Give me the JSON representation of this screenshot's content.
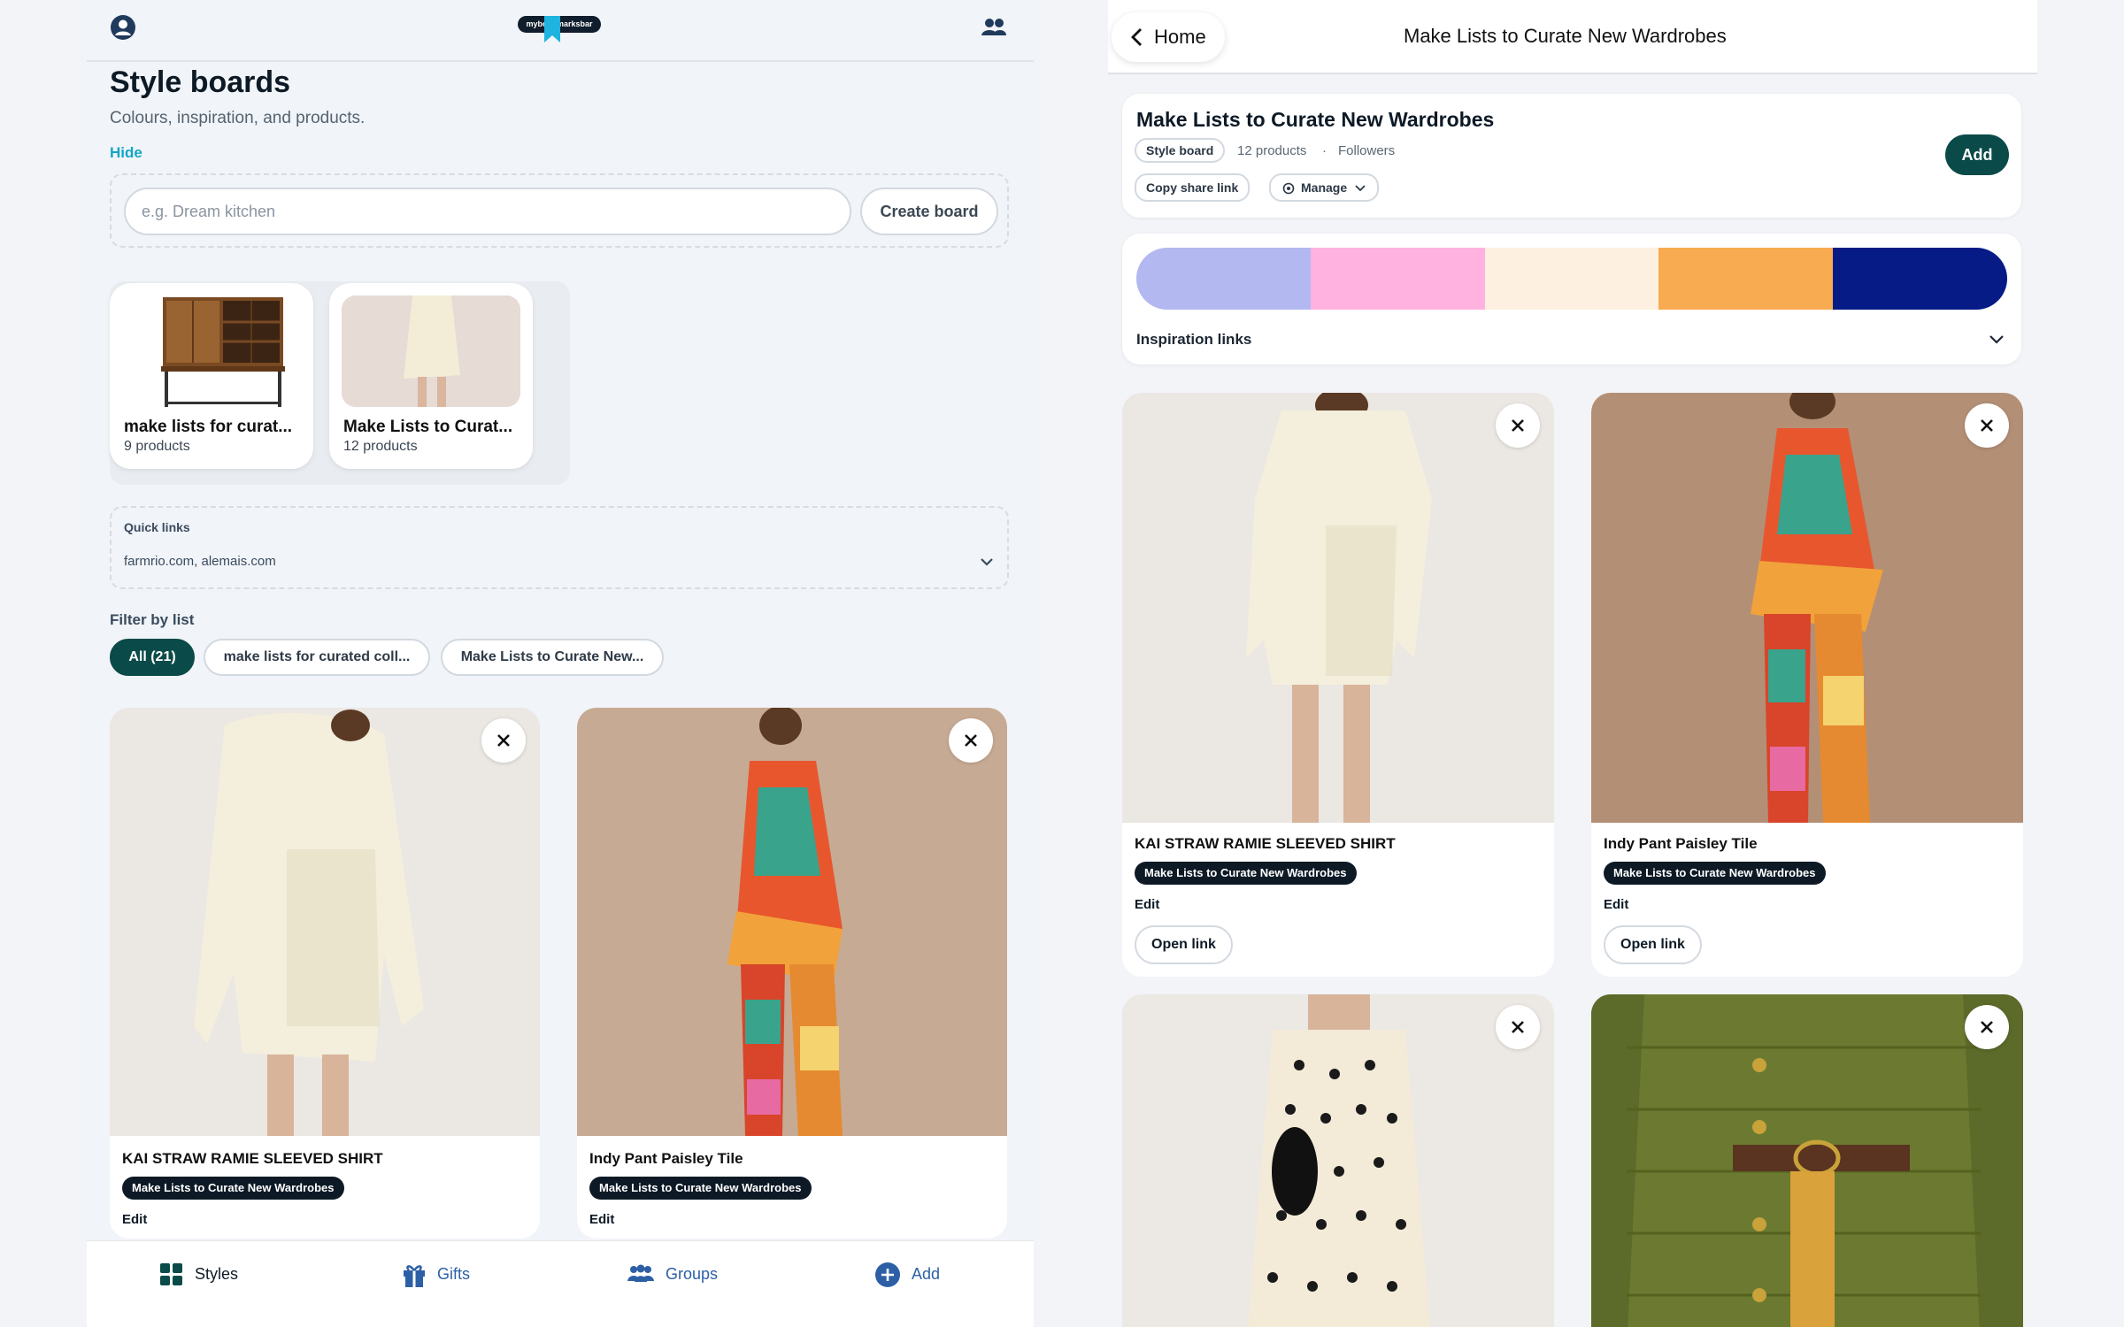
{
  "left": {
    "header": {
      "logo_text": "mybookmarksbar"
    },
    "title": "Style boards",
    "subtitle": "Colours, inspiration, and products.",
    "hide_label": "Hide",
    "create": {
      "placeholder": "e.g. Dream kitchen",
      "button": "Create board"
    },
    "boards": [
      {
        "name": "make lists for curat...",
        "count": "9 products"
      },
      {
        "name": "Make Lists to Curat...",
        "count": "12 products"
      }
    ],
    "quick_links": {
      "title": "Quick links",
      "value": "farmrio.com, alemais.com"
    },
    "filter": {
      "label": "Filter by list",
      "chips": [
        "All (21)",
        "make lists for curated coll...",
        "Make Lists to Curate New..."
      ]
    },
    "products": [
      {
        "title": "KAI STRAW RAMIE SLEEVED SHIRT",
        "tag": "Make Lists to Curate New Wardrobes",
        "edit": "Edit"
      },
      {
        "title": "Indy Pant Paisley Tile",
        "tag": "Make Lists to Curate New Wardrobes",
        "edit": "Edit"
      }
    ],
    "nav": [
      "Styles",
      "Gifts",
      "Groups",
      "Add"
    ]
  },
  "right": {
    "back_label": "Home",
    "header_title": "Make Lists to Curate New Wardrobes",
    "board": {
      "title": "Make Lists to Curate New Wardrobes",
      "badge": "Style board",
      "products": "12 products",
      "separator": "·",
      "followers": "Followers",
      "copy_link": "Copy share link",
      "manage": "Manage",
      "add": "Add"
    },
    "palette": [
      "#b3b8f0",
      "#ffb2e0",
      "#fdf0e0",
      "#f8ab50",
      "#061b86"
    ],
    "inspiration_label": "Inspiration links",
    "products": [
      {
        "title": "KAI STRAW RAMIE SLEEVED SHIRT",
        "tag": "Make Lists to Curate New Wardrobes",
        "edit": "Edit",
        "open": "Open link"
      },
      {
        "title": "Indy Pant Paisley Tile",
        "tag": "Make Lists to Curate New Wardrobes",
        "edit": "Edit",
        "open": "Open link"
      }
    ]
  },
  "colors": {
    "accent": "#0a4a48",
    "link": "#13a6c6",
    "nav_icon": "#2d5fa6"
  }
}
